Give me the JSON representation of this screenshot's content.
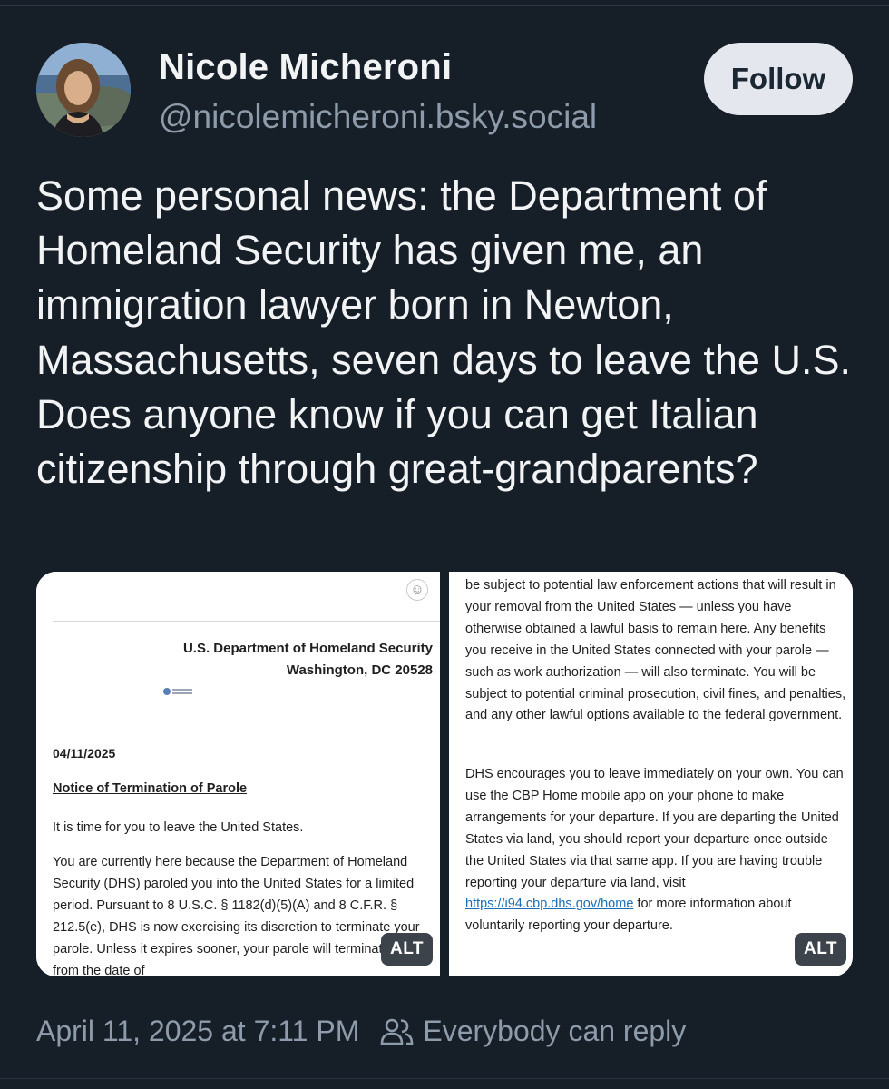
{
  "post": {
    "author": {
      "display_name": "Nicole Micheroni",
      "handle": "@nicolemicheroni.bsky.social"
    },
    "follow_label": "Follow",
    "text": "Some personal news: the Department of Homeland Security has given me, an immigration lawyer born in Newton, Massachusetts, seven days to leave the U.S. Does anyone know if you can get Italian citizenship through great-grandparents?",
    "images": [
      {
        "alt_label": "ALT",
        "emoji_glyph": "☺",
        "agency": "U.S. Department of Homeland Security",
        "city": "Washington, DC 20528",
        "date": "04/11/2025",
        "heading": "Notice of Termination of Parole",
        "line1": "It is time for you to leave the United States.",
        "paragraph": "You are currently here because the Department of Homeland Security (DHS) paroled you into the United States for a limited period. Pursuant to 8 U.S.C. § 1182(d)(5)(A) and 8 C.F.R. § 212.5(e), DHS is now exercising its discretion to terminate your parole. Unless it expires sooner, your parole will terminate 7 days from the date of"
      },
      {
        "alt_label": "ALT",
        "paragraph1": "be subject to potential law enforcement actions that will result in your removal from the United States — unless you have otherwise obtained a lawful basis to remain here. Any benefits you receive in the United States connected with your parole — such as work authorization — will also terminate. You will be subject to potential criminal prosecution, civil fines, and penalties, and any other lawful options available to the federal government.",
        "paragraph2_before_link": "DHS encourages you to leave immediately on your own. You can use the CBP Home mobile app on your phone to make arrangements for your departure. If you are departing the United States via land, you should report your departure once outside the United States via that same app. If you are having trouble reporting your departure via land, visit ",
        "link": "https://i94.cbp.dhs.gov/home",
        "paragraph2_after_link": " for more information about voluntarily reporting your departure."
      }
    ],
    "timestamp": "April 11, 2025 at 7:11 PM",
    "reply_setting": "Everybody can reply"
  },
  "icons": {
    "reply_setting_icon": "people-icon",
    "avatar": "profile-photo"
  }
}
